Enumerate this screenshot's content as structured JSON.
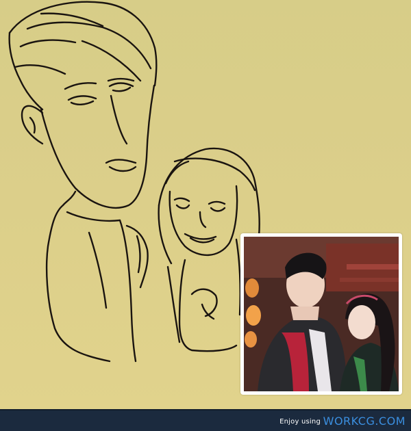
{
  "artwork": {
    "description_name": "caricature-sketch",
    "background_color": "#dccf8a",
    "line_color": "#1a1410"
  },
  "inset_photo": {
    "frame_color": "#ffffff"
  },
  "footer": {
    "tagline": "Enjoy using",
    "brand": "WORKCG.COM",
    "background_color": "#1b2a3e",
    "brand_color": "#3b8fe0"
  }
}
